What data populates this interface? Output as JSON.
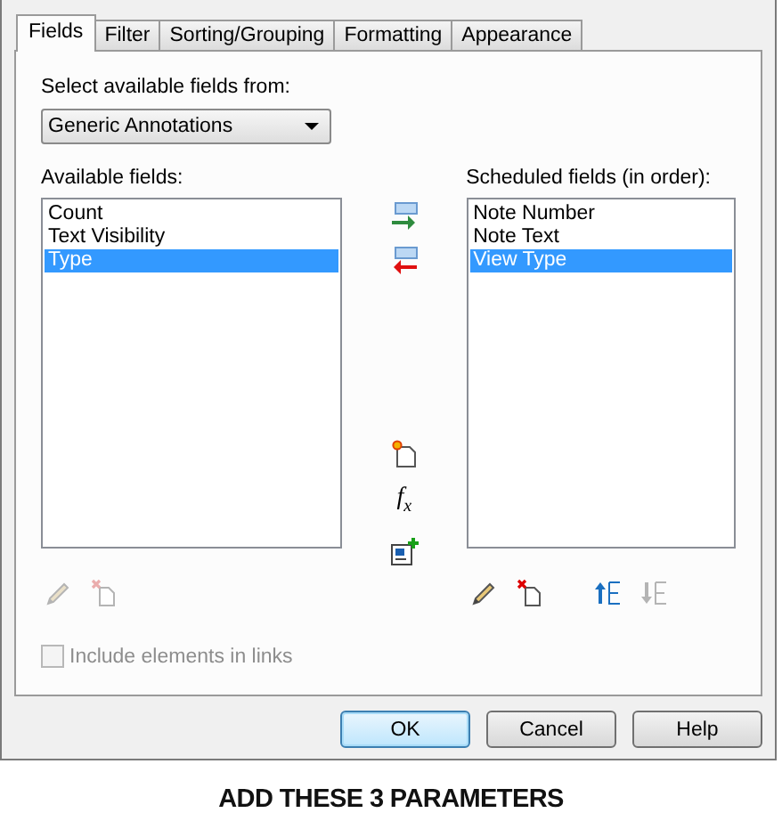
{
  "tabs": [
    {
      "label": "Fields",
      "selected": true
    },
    {
      "label": "Filter",
      "selected": false
    },
    {
      "label": "Sorting/Grouping",
      "selected": false
    },
    {
      "label": "Formatting",
      "selected": false
    },
    {
      "label": "Appearance",
      "selected": false
    }
  ],
  "source_label": "Select available fields from:",
  "source_select": {
    "value": "Generic Annotations"
  },
  "available": {
    "label": "Available fields:",
    "items": [
      {
        "text": "Count",
        "selected": false
      },
      {
        "text": "Text Visibility",
        "selected": false
      },
      {
        "text": "Type",
        "selected": true
      }
    ],
    "tools": [
      {
        "kind": "edit",
        "disabled": true
      },
      {
        "kind": "delete",
        "disabled": true
      }
    ]
  },
  "transfer_tools": [
    {
      "kind": "add"
    },
    {
      "kind": "remove"
    },
    {
      "kind": "gap"
    },
    {
      "kind": "new"
    },
    {
      "kind": "formula",
      "text": "f$_{x}$"
    },
    {
      "kind": "combine"
    }
  ],
  "scheduled": {
    "label": "Scheduled fields (in order):",
    "items": [
      {
        "text": "Note Number",
        "selected": false
      },
      {
        "text": "Note Text",
        "selected": false
      },
      {
        "text": "View Type",
        "selected": true
      }
    ],
    "tools": [
      {
        "kind": "edit",
        "disabled": false
      },
      {
        "kind": "delete",
        "disabled": false
      },
      {
        "kind": "up",
        "disabled": false
      },
      {
        "kind": "down",
        "disabled": true
      }
    ]
  },
  "include_links": {
    "label": "Include elements in links",
    "checked": false,
    "disabled": true
  },
  "buttons": [
    {
      "label": "OK",
      "default": true
    },
    {
      "label": "Cancel",
      "default": false
    },
    {
      "label": "Help",
      "default": false
    }
  ],
  "caption": "ADD THESE 3 PARAMETERS"
}
